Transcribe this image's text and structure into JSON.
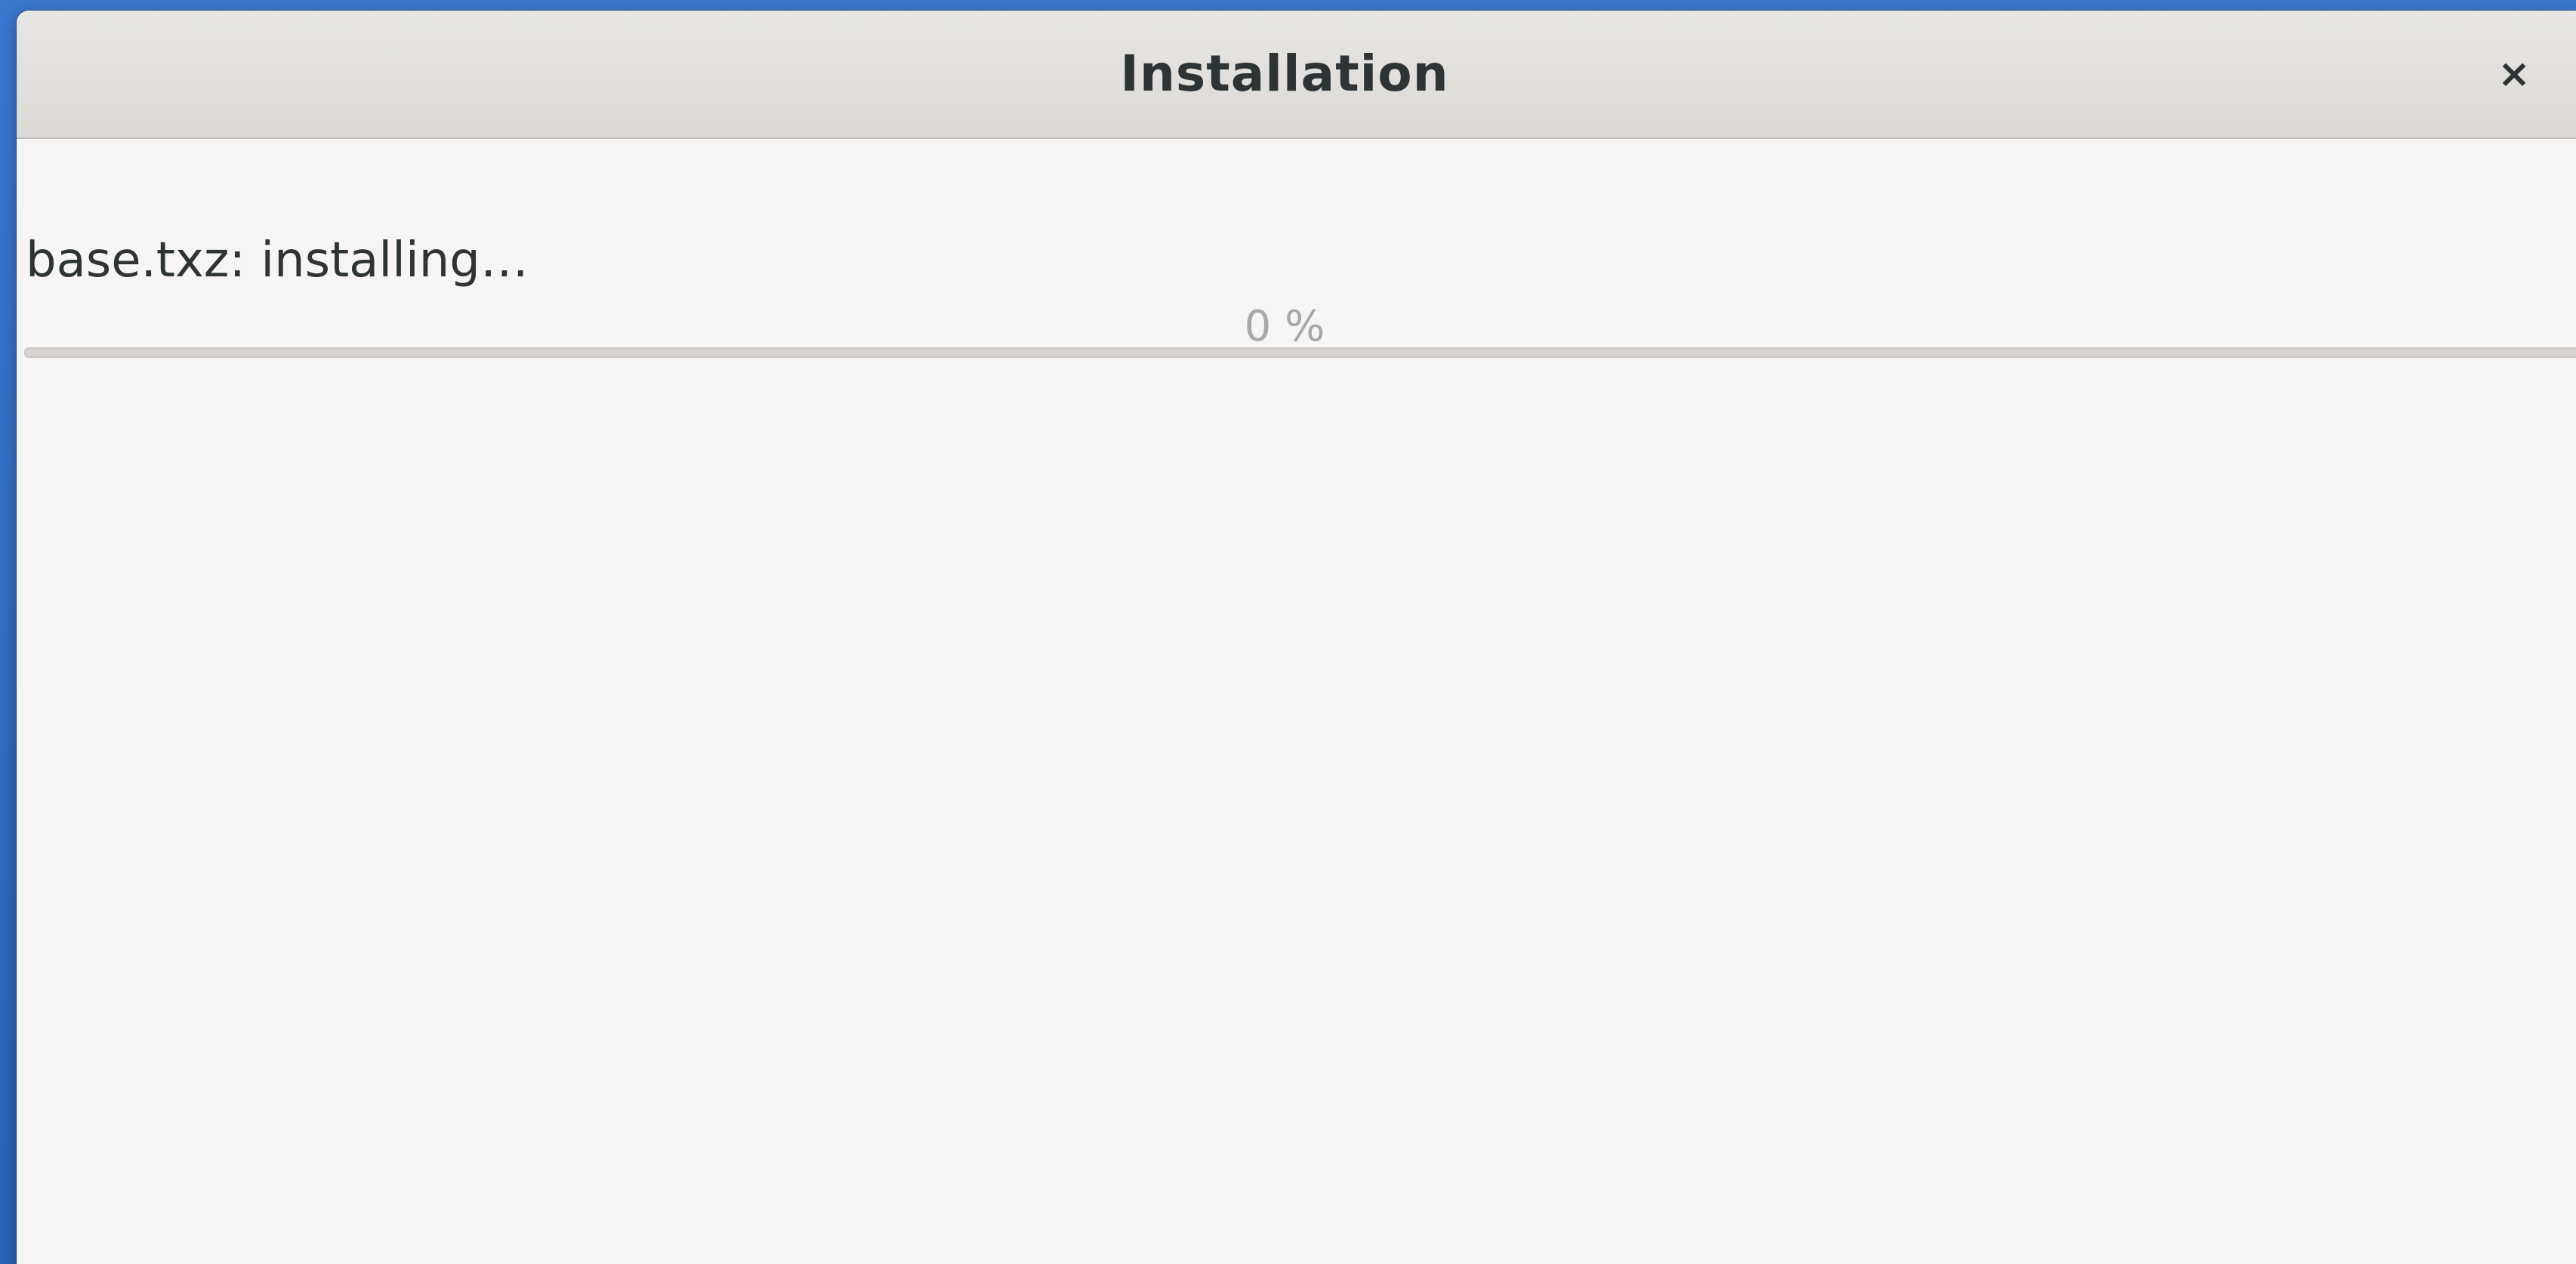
{
  "window": {
    "title": "Installation",
    "close_label": "×"
  },
  "install": {
    "status_text": "base.txz: installing…",
    "percent_text": "0 %",
    "progress_fraction": 0
  },
  "colors": {
    "accent": "#3584e4",
    "desktop": "#2f6fc7"
  }
}
